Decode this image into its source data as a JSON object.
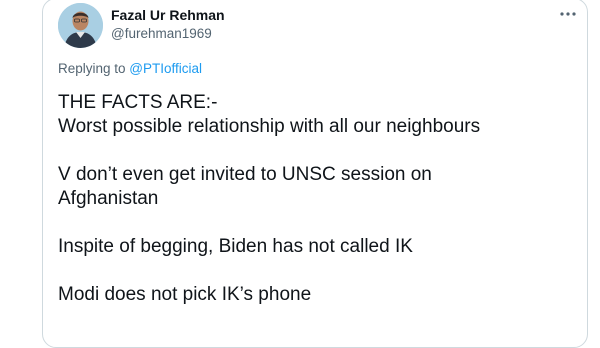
{
  "tweet": {
    "author": {
      "display_name": "Fazal Ur Rehman",
      "handle": "@furehman1969"
    },
    "more_icon": "more-horizontal-icon",
    "replying_to": {
      "prefix": "Replying to ",
      "mention": "@PTIofficial"
    },
    "paragraphs": [
      {
        "lines": [
          "THE FACTS ARE:-",
          "Worst possible relationship with all our neighbours"
        ]
      },
      {
        "lines": [
          "V don’t even get invited to UNSC session on",
          "Afghanistan"
        ]
      },
      {
        "lines": [
          "Inspite of begging, Biden has not called IK"
        ]
      },
      {
        "lines": [
          "Modi does not pick IK’s phone"
        ]
      }
    ]
  },
  "colors": {
    "text_primary": "#0f1419",
    "text_secondary": "#536471",
    "link": "#1d9bf0",
    "border": "#cfd9de"
  }
}
